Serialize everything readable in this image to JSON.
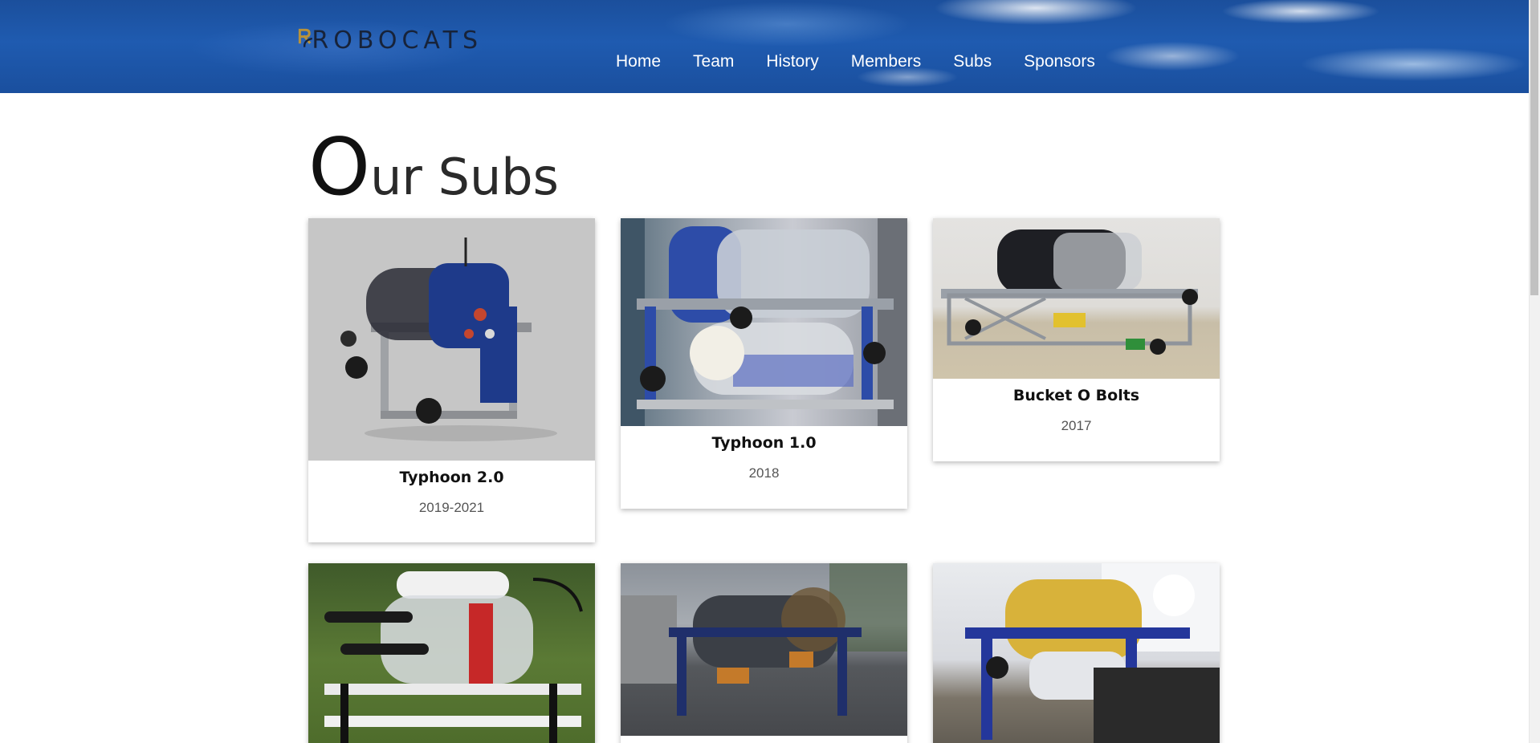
{
  "header": {
    "logo_text": "ROBOCATS",
    "nav": [
      "Home",
      "Team",
      "History",
      "Members",
      "Subs",
      "Sponsors"
    ]
  },
  "page": {
    "title_first": "O",
    "title_rest": "ur Subs"
  },
  "subs": [
    {
      "name": "Typhoon 2.0",
      "year": "2019-2021"
    },
    {
      "name": "Typhoon 1.0",
      "year": "2018"
    },
    {
      "name": "Bucket O Bolts",
      "year": "2017"
    },
    {
      "name": "",
      "year": ""
    },
    {
      "name": "",
      "year": ""
    },
    {
      "name": "",
      "year": ""
    }
  ],
  "colors": {
    "header_blue": "#1f5bb0",
    "logo_gold": "#b8923a",
    "text_dark": "#111111"
  }
}
